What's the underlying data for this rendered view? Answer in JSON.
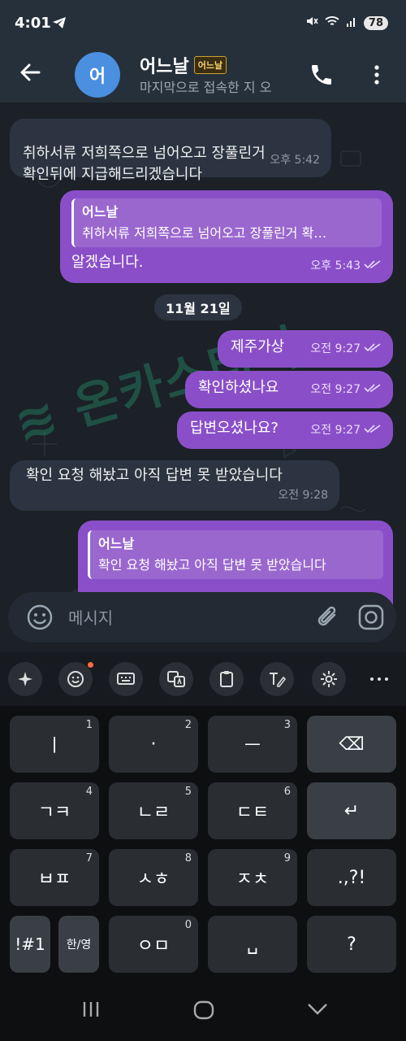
{
  "status_bar": {
    "time": "4:01",
    "battery": "78"
  },
  "header": {
    "avatar_letter": "어",
    "name": "어느날",
    "name_badge": "어느날",
    "status": "마지막으로 접속한 지 오"
  },
  "messages": [
    {
      "type": "in",
      "text": "취하서류 저희쪽으로 넘어오고 장풀린거\n확인뒤에 지급해드리겠습니다",
      "time": "오후 5:42"
    },
    {
      "type": "out",
      "quote_name": "어느날",
      "quote_text": "취하서류 저희쪽으로 넘어오고 장풀린거 확…",
      "text": "알겠습니다.",
      "time": "오후 5:43"
    },
    {
      "type": "date",
      "text": "11월 21일"
    },
    {
      "type": "out",
      "text": "제주가상",
      "time": "오전 9:27"
    },
    {
      "type": "out",
      "text": "확인하셨나요",
      "time": "오전 9:27"
    },
    {
      "type": "out",
      "text": "답변오셨나요?",
      "time": "오전 9:27"
    },
    {
      "type": "in",
      "text": "확인 요청 해놨고 아직 답변 못 받았습니다",
      "time": "오전 9:28"
    },
    {
      "type": "out",
      "quote_name": "어느날",
      "quote_text": "확인 요청 해놨고 아직 답변 못 받았습니다"
    }
  ],
  "composer": {
    "placeholder": "메시지"
  },
  "keyboard": {
    "toolbar": [
      "ai-icon",
      "emoji-icon",
      "keyboard-icon",
      "translate-icon",
      "clipboard-icon",
      "handwriting-icon",
      "settings-icon",
      "more-icon"
    ],
    "rows": [
      [
        {
          "label": "ㅣ",
          "num": "1"
        },
        {
          "label": "·",
          "num": "2"
        },
        {
          "label": "ㅡ",
          "num": "3"
        },
        {
          "label": "⌫",
          "num": ""
        }
      ],
      [
        {
          "label": "ㄱㅋ",
          "num": "4"
        },
        {
          "label": "ㄴㄹ",
          "num": "5"
        },
        {
          "label": "ㄷㅌ",
          "num": "6"
        },
        {
          "label": "↵",
          "num": ""
        }
      ],
      [
        {
          "label": "ㅂㅍ",
          "num": "7"
        },
        {
          "label": "ㅅㅎ",
          "num": "8"
        },
        {
          "label": "ㅈㅊ",
          "num": "9"
        },
        {
          "label": ".,?!",
          "num": ""
        }
      ],
      [
        {
          "label": "!#1",
          "num": ""
        },
        {
          "label": "한/영",
          "num": ""
        },
        {
          "label": "ㅇㅁ",
          "num": "0"
        },
        {
          "label": "␣",
          "num": ""
        },
        {
          "label": "?",
          "num": ""
        }
      ]
    ]
  }
}
